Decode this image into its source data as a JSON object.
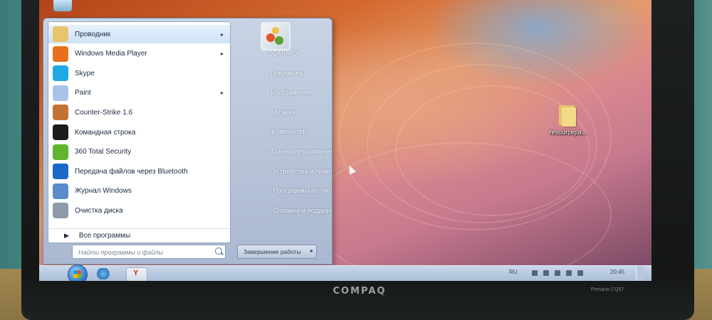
{
  "laptop": {
    "brand": "COMPAQ",
    "model": "Presario CQ57"
  },
  "start_menu": {
    "programs": [
      {
        "label": "Проводник",
        "icon": "explorer-folder-icon",
        "color": "#e8c46a",
        "submenu": true
      },
      {
        "label": "Windows Media Player",
        "icon": "media-player-icon",
        "color": "#e8701d",
        "submenu": true
      },
      {
        "label": "Skype",
        "icon": "skype-icon",
        "color": "#1ea8e4",
        "submenu": false
      },
      {
        "label": "Paint",
        "icon": "paint-icon",
        "color": "#a7c4e6",
        "submenu": true
      },
      {
        "label": "Counter-Strike 1.6",
        "icon": "counter-strike-icon",
        "color": "#c27234",
        "submenu": false
      },
      {
        "label": "Командная строка",
        "icon": "command-prompt-icon",
        "color": "#1b1b1b",
        "submenu": false
      },
      {
        "label": "360 Total Security",
        "icon": "total-security-icon",
        "color": "#5fb52d",
        "submenu": false
      },
      {
        "label": "Передача файлов через Bluetooth",
        "icon": "bluetooth-icon",
        "color": "#1a68c7",
        "submenu": false
      },
      {
        "label": "Журнал Windows",
        "icon": "windows-journal-icon",
        "color": "#5b8bc9",
        "submenu": false
      },
      {
        "label": "Очистка диска",
        "icon": "disk-cleanup-icon",
        "color": "#8c9aab",
        "submenu": false
      }
    ],
    "all_programs": "Все программы",
    "search_placeholder": "Найти программы и файлы",
    "right_items": [
      "COMPAQ",
      "Документы",
      "Изображения",
      "Музыка",
      "Компьютер",
      "Панель управления",
      "Устройства и принтеры",
      "Программы по умолчанию",
      "Справка и поддержка"
    ],
    "shutdown_label": "Завершение работы"
  },
  "desktop": {
    "icon_label": "resourcepa..."
  },
  "taskbar": {
    "yandex_label": "Y",
    "language": "RU",
    "clock": "20:45"
  }
}
